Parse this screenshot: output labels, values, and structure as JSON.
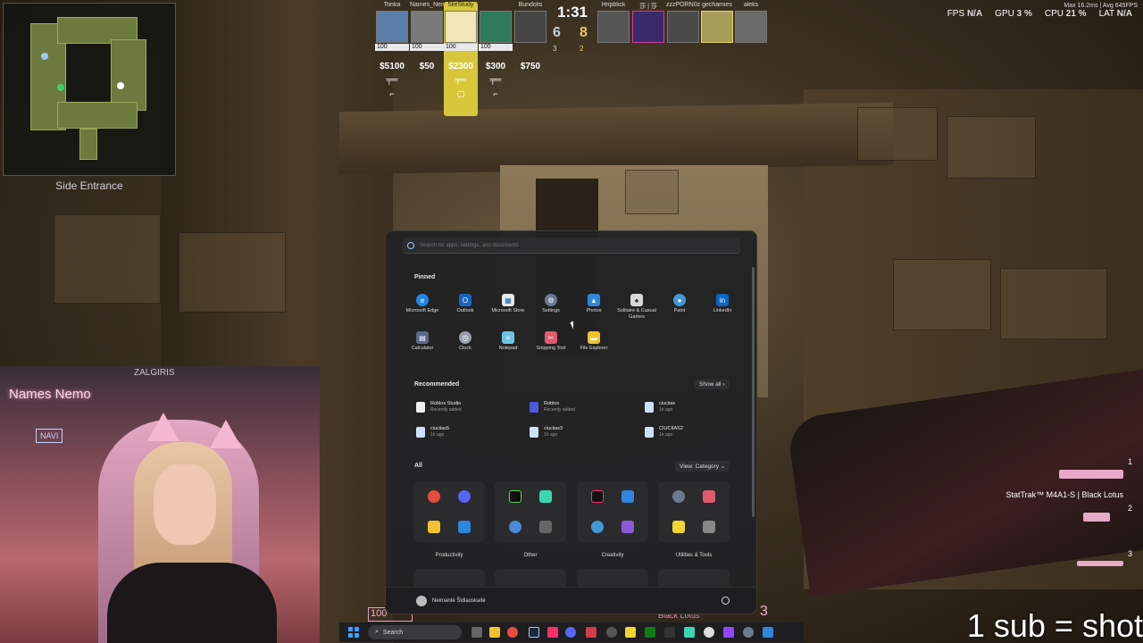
{
  "map": {
    "location": "Side Entrance"
  },
  "hud": {
    "timer": "1:31",
    "score_ct": "6",
    "score_t": "8",
    "alive_ct": "3",
    "alive_t": "2",
    "ct_players": [
      {
        "name": "Tonka",
        "hp": "100",
        "money": "$5100"
      },
      {
        "name": "Names_Nemo",
        "hp": "100",
        "money": "$50"
      },
      {
        "name": "5lieStudy",
        "hp": "100",
        "money": "$2300"
      },
      {
        "name": "",
        "hp": "100",
        "money": "$300"
      },
      {
        "name": "Bundolis",
        "hp": "",
        "money": "$750"
      }
    ],
    "t_players": [
      {
        "name": "Hripblick"
      },
      {
        "name": "莎 | 莎"
      },
      {
        "name": "zzzPORN0z"
      },
      {
        "name": ""
      },
      {
        "name": "gechamies"
      },
      {
        "name": "aleks"
      }
    ],
    "stats": {
      "fps_label": "FPS",
      "fps": "N/A",
      "gpu_label": "GPU",
      "gpu": "3 %",
      "cpu_label": "CPU",
      "cpu": "21 %",
      "lat_label": "LAT",
      "lat": "N/A"
    },
    "latency": "Max 16.2ms | Avg 645FPS"
  },
  "weapons": {
    "slot1": "1",
    "slot2": "2",
    "slot3": "3",
    "primary_name": "StatTrak™ M4A1-S | Black Lotus",
    "hp": "100",
    "skin_bottom": "Black Lotus",
    "ammo": "3"
  },
  "webcam": {
    "sign": "Names Nemo",
    "logo": "NAVI",
    "wall_sign": "ZALGIRIS"
  },
  "start_menu": {
    "search_placeholder": "Search for apps, settings, and documents",
    "pinned_label": "Pinned",
    "pinned": [
      {
        "label": "Microsoft Edge",
        "color": "#1e88e5"
      },
      {
        "label": "Outlook",
        "color": "#1565c0"
      },
      {
        "label": "Microsoft Store",
        "color": "#e8e8e8"
      },
      {
        "label": "Settings",
        "color": "#6b7a90"
      },
      {
        "label": "Photos",
        "color": "#2e86de"
      },
      {
        "label": "Solitaire & Casual Games",
        "color": "#d8d8d8"
      },
      {
        "label": "Paint",
        "color": "#3f9ad6"
      },
      {
        "label": "LinkedIn",
        "color": "#0a66c2"
      },
      {
        "label": "Calculator",
        "color": "#5a6a8a"
      },
      {
        "label": "Clock",
        "color": "#9aa0aa"
      },
      {
        "label": "Notepad",
        "color": "#6cc3e6"
      },
      {
        "label": "Snipping Tool",
        "color": "#e05a6b"
      },
      {
        "label": "File Explorer",
        "color": "#f2c230"
      }
    ],
    "recommended_label": "Recommended",
    "show_all": "Show all",
    "recommended": [
      {
        "title": "Roblox Studio",
        "sub": "Recently added"
      },
      {
        "title": "Roblox",
        "sub": "Recently added"
      },
      {
        "title": "ciuciias",
        "sub": "1h ago"
      },
      {
        "title": "ciuciias5",
        "sub": "1h ago"
      },
      {
        "title": "ciuciias3",
        "sub": "1h ago"
      },
      {
        "title": "CIUCIIAS2",
        "sub": "1h ago"
      }
    ],
    "all_label": "All",
    "view_label": "View: Category",
    "categories": [
      "Productivity",
      "Other",
      "Creativity",
      "Utilities & Tools"
    ],
    "user": "Neimantė Šidlauskaitė"
  },
  "taskbar": {
    "search_label": "Search"
  },
  "overlay": {
    "sub_text": "1 sub = shot"
  }
}
